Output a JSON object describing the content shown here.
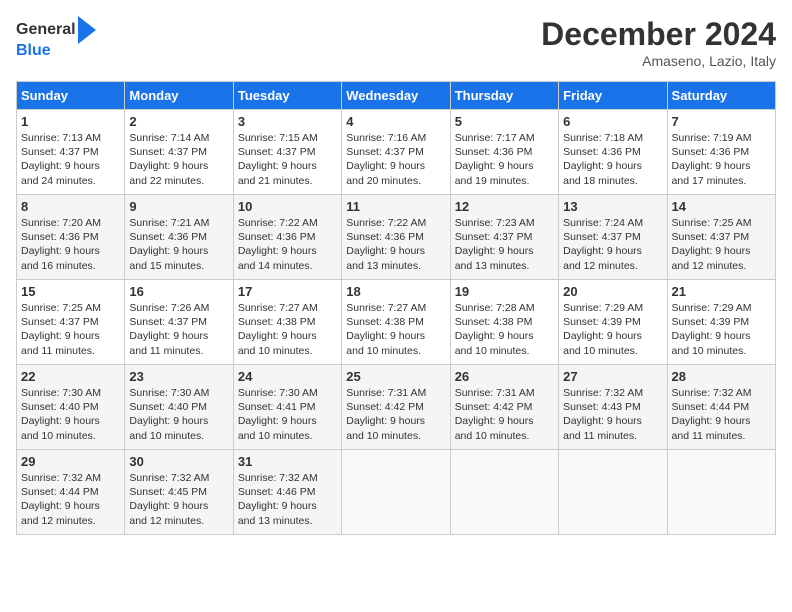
{
  "header": {
    "logo_general": "General",
    "logo_blue": "Blue",
    "title": "December 2024",
    "location": "Amaseno, Lazio, Italy"
  },
  "days_of_week": [
    "Sunday",
    "Monday",
    "Tuesday",
    "Wednesday",
    "Thursday",
    "Friday",
    "Saturday"
  ],
  "weeks": [
    [
      {
        "day": "1",
        "sunrise": "7:13 AM",
        "sunset": "4:37 PM",
        "daylight_hours": "9",
        "daylight_minutes": "24"
      },
      {
        "day": "2",
        "sunrise": "7:14 AM",
        "sunset": "4:37 PM",
        "daylight_hours": "9",
        "daylight_minutes": "22"
      },
      {
        "day": "3",
        "sunrise": "7:15 AM",
        "sunset": "4:37 PM",
        "daylight_hours": "9",
        "daylight_minutes": "21"
      },
      {
        "day": "4",
        "sunrise": "7:16 AM",
        "sunset": "4:37 PM",
        "daylight_hours": "9",
        "daylight_minutes": "20"
      },
      {
        "day": "5",
        "sunrise": "7:17 AM",
        "sunset": "4:36 PM",
        "daylight_hours": "9",
        "daylight_minutes": "19"
      },
      {
        "day": "6",
        "sunrise": "7:18 AM",
        "sunset": "4:36 PM",
        "daylight_hours": "9",
        "daylight_minutes": "18"
      },
      {
        "day": "7",
        "sunrise": "7:19 AM",
        "sunset": "4:36 PM",
        "daylight_hours": "9",
        "daylight_minutes": "17"
      }
    ],
    [
      {
        "day": "8",
        "sunrise": "7:20 AM",
        "sunset": "4:36 PM",
        "daylight_hours": "9",
        "daylight_minutes": "16"
      },
      {
        "day": "9",
        "sunrise": "7:21 AM",
        "sunset": "4:36 PM",
        "daylight_hours": "9",
        "daylight_minutes": "15"
      },
      {
        "day": "10",
        "sunrise": "7:22 AM",
        "sunset": "4:36 PM",
        "daylight_hours": "9",
        "daylight_minutes": "14"
      },
      {
        "day": "11",
        "sunrise": "7:22 AM",
        "sunset": "4:36 PM",
        "daylight_hours": "9",
        "daylight_minutes": "13"
      },
      {
        "day": "12",
        "sunrise": "7:23 AM",
        "sunset": "4:37 PM",
        "daylight_hours": "9",
        "daylight_minutes": "13"
      },
      {
        "day": "13",
        "sunrise": "7:24 AM",
        "sunset": "4:37 PM",
        "daylight_hours": "9",
        "daylight_minutes": "12"
      },
      {
        "day": "14",
        "sunrise": "7:25 AM",
        "sunset": "4:37 PM",
        "daylight_hours": "9",
        "daylight_minutes": "12"
      }
    ],
    [
      {
        "day": "15",
        "sunrise": "7:25 AM",
        "sunset": "4:37 PM",
        "daylight_hours": "9",
        "daylight_minutes": "11"
      },
      {
        "day": "16",
        "sunrise": "7:26 AM",
        "sunset": "4:37 PM",
        "daylight_hours": "9",
        "daylight_minutes": "11"
      },
      {
        "day": "17",
        "sunrise": "7:27 AM",
        "sunset": "4:38 PM",
        "daylight_hours": "9",
        "daylight_minutes": "10"
      },
      {
        "day": "18",
        "sunrise": "7:27 AM",
        "sunset": "4:38 PM",
        "daylight_hours": "9",
        "daylight_minutes": "10"
      },
      {
        "day": "19",
        "sunrise": "7:28 AM",
        "sunset": "4:38 PM",
        "daylight_hours": "9",
        "daylight_minutes": "10"
      },
      {
        "day": "20",
        "sunrise": "7:29 AM",
        "sunset": "4:39 PM",
        "daylight_hours": "9",
        "daylight_minutes": "10"
      },
      {
        "day": "21",
        "sunrise": "7:29 AM",
        "sunset": "4:39 PM",
        "daylight_hours": "9",
        "daylight_minutes": "10"
      }
    ],
    [
      {
        "day": "22",
        "sunrise": "7:30 AM",
        "sunset": "4:40 PM",
        "daylight_hours": "9",
        "daylight_minutes": "10"
      },
      {
        "day": "23",
        "sunrise": "7:30 AM",
        "sunset": "4:40 PM",
        "daylight_hours": "9",
        "daylight_minutes": "10"
      },
      {
        "day": "24",
        "sunrise": "7:30 AM",
        "sunset": "4:41 PM",
        "daylight_hours": "9",
        "daylight_minutes": "10"
      },
      {
        "day": "25",
        "sunrise": "7:31 AM",
        "sunset": "4:42 PM",
        "daylight_hours": "9",
        "daylight_minutes": "10"
      },
      {
        "day": "26",
        "sunrise": "7:31 AM",
        "sunset": "4:42 PM",
        "daylight_hours": "9",
        "daylight_minutes": "10"
      },
      {
        "day": "27",
        "sunrise": "7:32 AM",
        "sunset": "4:43 PM",
        "daylight_hours": "9",
        "daylight_minutes": "11"
      },
      {
        "day": "28",
        "sunrise": "7:32 AM",
        "sunset": "4:44 PM",
        "daylight_hours": "9",
        "daylight_minutes": "11"
      }
    ],
    [
      {
        "day": "29",
        "sunrise": "7:32 AM",
        "sunset": "4:44 PM",
        "daylight_hours": "9",
        "daylight_minutes": "12"
      },
      {
        "day": "30",
        "sunrise": "7:32 AM",
        "sunset": "4:45 PM",
        "daylight_hours": "9",
        "daylight_minutes": "12"
      },
      {
        "day": "31",
        "sunrise": "7:32 AM",
        "sunset": "4:46 PM",
        "daylight_hours": "9",
        "daylight_minutes": "13"
      },
      null,
      null,
      null,
      null
    ]
  ]
}
